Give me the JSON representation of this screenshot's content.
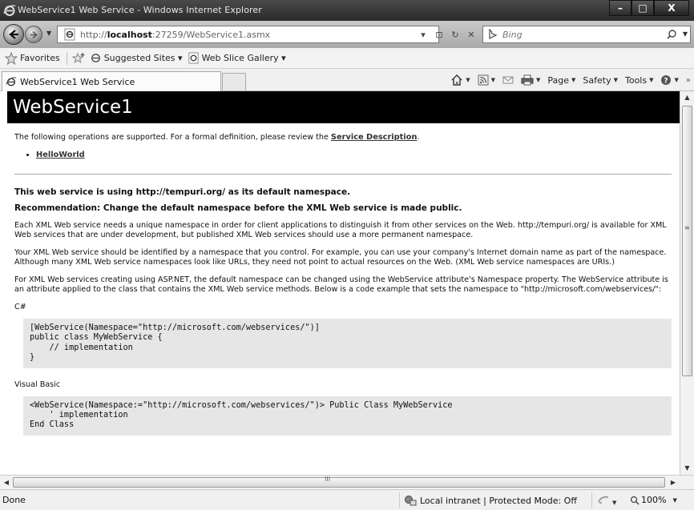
{
  "window": {
    "title": "WebService1 Web Service - Windows Internet Explorer",
    "min_label": "–",
    "max_label": "□",
    "close_label": "X"
  },
  "address": {
    "url_prefix": "http://",
    "url_host": "localhost",
    "url_rest": ":27259/WebService1.asmx",
    "search_placeholder": "Bing"
  },
  "favorites": {
    "favorites_label": "Favorites",
    "suggested_label": "Suggested Sites ▾",
    "slice_label": "Web Slice Gallery ▾"
  },
  "tabs": {
    "active_label": "WebService1 Web Service"
  },
  "commandbar": {
    "page": "Page",
    "safety": "Safety",
    "tools": "Tools",
    "overflow": "»"
  },
  "content": {
    "heading": "WebService1",
    "intro_text": "The following operations are supported. For a formal definition, please review the ",
    "service_desc_link": "Service Description",
    "intro_end": ".",
    "operations": [
      "HelloWorld"
    ],
    "ns_heading": "This web service is using http://tempuri.org/ as its default namespace.",
    "rec_heading": "Recommendation: Change the default namespace before the XML Web service is made public.",
    "para1": "Each XML Web service needs a unique namespace in order for client applications to distinguish it from other services on the Web. http://tempuri.org/ is available for XML Web services that are under development, but published XML Web services should use a more permanent namespace.",
    "para2": "Your XML Web service should be identified by a namespace that you control. For example, you can use your company's Internet domain name as part of the namespace. Although many XML Web service namespaces look like URLs, they need not point to actual resources on the Web. (XML Web service namespaces are URIs.)",
    "para3": "For XML Web services creating using ASP.NET, the default namespace can be changed using the WebService attribute's Namespace property. The WebService attribute is an attribute applied to the class that contains the XML Web service methods. Below is a code example that sets the namespace to \"http://microsoft.com/webservices/\":",
    "csharp_label": "C#",
    "csharp_code": "[WebService(Namespace=\"http://microsoft.com/webservices/\")]\npublic class MyWebService {\n    // implementation\n}",
    "vb_label": "Visual Basic",
    "vb_code": "<WebService(Namespace:=\"http://microsoft.com/webservices/\")> Public Class MyWebService\n    ' implementation\nEnd Class"
  },
  "status": {
    "done": "Done",
    "zone": "Local intranet | Protected Mode: Off",
    "zoom": "100%"
  }
}
